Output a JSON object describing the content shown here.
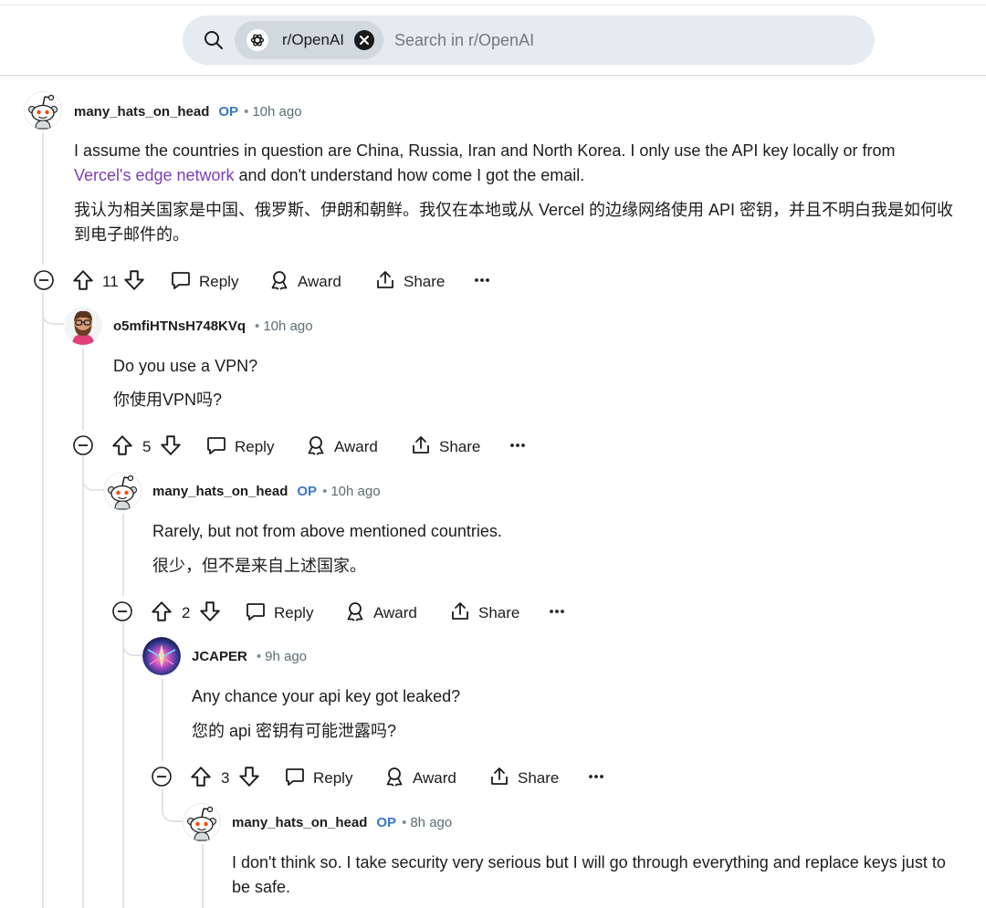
{
  "search": {
    "community": "r/OpenAI",
    "placeholder": "Search in r/OpenAI"
  },
  "labels": {
    "reply": "Reply",
    "award": "Award",
    "share": "Share",
    "op_badge": "OP",
    "dot": "•",
    "more": "···"
  },
  "comments": [
    {
      "user": "many_hats_on_head",
      "op": true,
      "time": "10h ago",
      "body": {
        "prefix": "I assume the countries in question are China, Russia, Iran and North Korea. I only use the API key locally or from",
        "link": "Vercel's edge network",
        "suffix": " and don't understand how come I got the email.",
        "translation": "我认为相关国家是中国、俄罗斯、伊朗和朝鲜。我仅在本地或从 Vercel 的边缘网络使用 API 密钥，并且不明白我是如何收到电子邮件的。"
      },
      "votes": "11"
    },
    {
      "user": "o5mfiHTNsH748KVq",
      "op": false,
      "time": "10h ago",
      "body": {
        "text": "Do you use a VPN?",
        "translation": "你使用VPN吗?"
      },
      "votes": "5"
    },
    {
      "user": "many_hats_on_head",
      "op": true,
      "time": "10h ago",
      "body": {
        "text": "Rarely, but not from above mentioned countries.",
        "translation": "很少，但不是来自上述国家。"
      },
      "votes": "2"
    },
    {
      "user": "JCAPER",
      "op": false,
      "time": "9h ago",
      "body": {
        "text": "Any chance your api key got leaked?",
        "translation": "您的 api 密钥有可能泄露吗?"
      },
      "votes": "3"
    },
    {
      "user": "many_hats_on_head",
      "op": true,
      "time": "8h ago",
      "body": {
        "text": "I don't think so. I take security very serious but I will go through everything and replace keys just to be safe."
      }
    }
  ],
  "colors": {
    "op_badge": "#3a78c9",
    "link": "#7b3fb5",
    "meta_gray": "#5c6c74",
    "thread_line": "#e1e4e6",
    "search_bg": "#e5ebee",
    "chip_bg": "#d0d9dd"
  },
  "icons": [
    "search-icon",
    "openai-logo-icon",
    "close-icon",
    "collapse-icon",
    "upvote-icon",
    "downvote-icon",
    "reply-icon",
    "award-icon",
    "share-icon",
    "more-icon",
    "snoo-avatar-icon"
  ]
}
